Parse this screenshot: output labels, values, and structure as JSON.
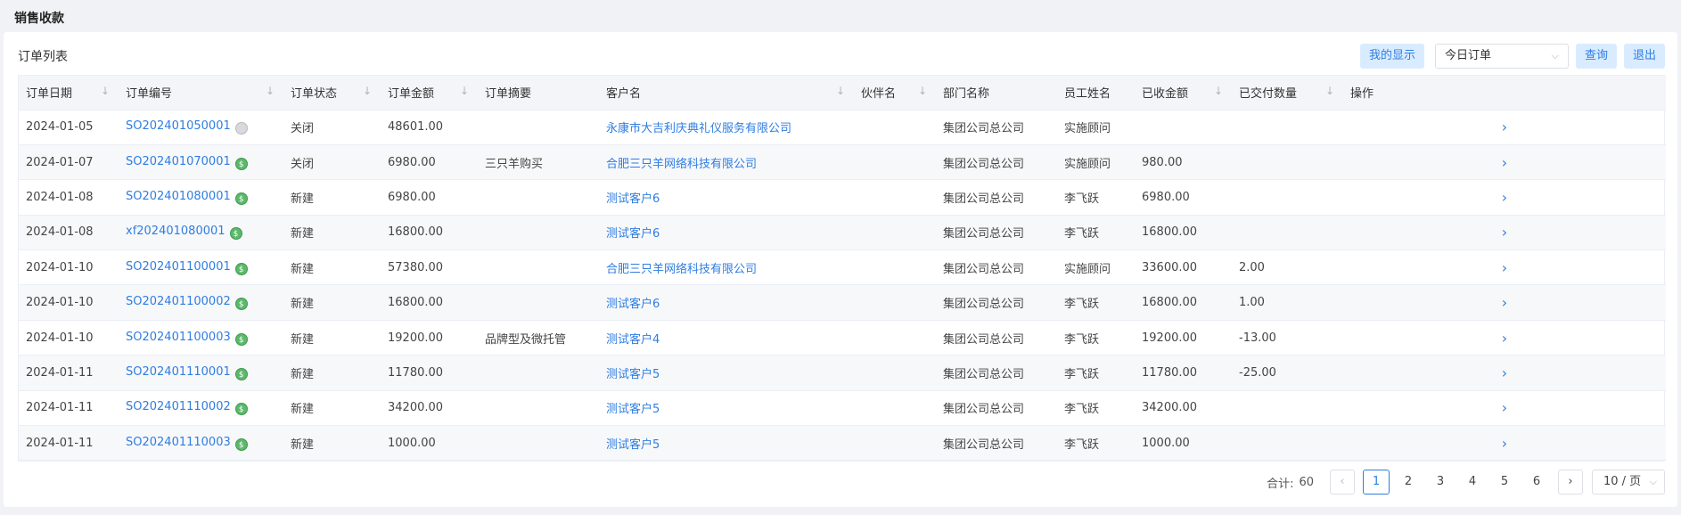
{
  "header": {
    "title": "销售收款"
  },
  "panel": {
    "title": "订单列表"
  },
  "toolbar": {
    "my_display": "我的显示",
    "filter_value": "今日订单",
    "query": "查询",
    "exit": "退出"
  },
  "table": {
    "columns": [
      "订单日期",
      "订单编号",
      "订单状态",
      "订单金额",
      "订单摘要",
      "客户名",
      "伙伴名",
      "部门名称",
      "员工姓名",
      "已收金额",
      "已交付数量",
      "操作"
    ],
    "rows": [
      {
        "date": "2024-01-05",
        "no": "SO202401050001",
        "pay": "grey",
        "status": "关闭",
        "amount": "48601.00",
        "summary": "",
        "customer": "永康市大吉利庆典礼仪服务有限公司",
        "partner": "",
        "dept": "集团公司总公司",
        "staff": "实施顾问",
        "received": "",
        "delivered": ""
      },
      {
        "date": "2024-01-07",
        "no": "SO202401070001",
        "pay": "green",
        "status": "关闭",
        "amount": "6980.00",
        "summary": "三只羊购买",
        "customer": "合肥三只羊网络科技有限公司",
        "partner": "",
        "dept": "集团公司总公司",
        "staff": "实施顾问",
        "received": "980.00",
        "delivered": ""
      },
      {
        "date": "2024-01-08",
        "no": "SO202401080001",
        "pay": "green",
        "status": "新建",
        "amount": "6980.00",
        "summary": "",
        "customer": "测试客户6",
        "partner": "",
        "dept": "集团公司总公司",
        "staff": "李飞跃",
        "received": "6980.00",
        "delivered": ""
      },
      {
        "date": "2024-01-08",
        "no": "xf202401080001",
        "pay": "green",
        "status": "新建",
        "amount": "16800.00",
        "summary": "",
        "customer": "测试客户6",
        "partner": "",
        "dept": "集团公司总公司",
        "staff": "李飞跃",
        "received": "16800.00",
        "delivered": ""
      },
      {
        "date": "2024-01-10",
        "no": "SO202401100001",
        "pay": "green",
        "status": "新建",
        "amount": "57380.00",
        "summary": "",
        "customer": "合肥三只羊网络科技有限公司",
        "partner": "",
        "dept": "集团公司总公司",
        "staff": "实施顾问",
        "received": "33600.00",
        "delivered": "2.00"
      },
      {
        "date": "2024-01-10",
        "no": "SO202401100002",
        "pay": "green",
        "status": "新建",
        "amount": "16800.00",
        "summary": "",
        "customer": "测试客户6",
        "partner": "",
        "dept": "集团公司总公司",
        "staff": "李飞跃",
        "received": "16800.00",
        "delivered": "1.00"
      },
      {
        "date": "2024-01-10",
        "no": "SO202401100003",
        "pay": "green",
        "status": "新建",
        "amount": "19200.00",
        "summary": "品牌型及微托管",
        "customer": "测试客户4",
        "partner": "",
        "dept": "集团公司总公司",
        "staff": "李飞跃",
        "received": "19200.00",
        "delivered": "-13.00"
      },
      {
        "date": "2024-01-11",
        "no": "SO202401110001",
        "pay": "green",
        "status": "新建",
        "amount": "11780.00",
        "summary": "",
        "customer": "测试客户5",
        "partner": "",
        "dept": "集团公司总公司",
        "staff": "李飞跃",
        "received": "11780.00",
        "delivered": "-25.00"
      },
      {
        "date": "2024-01-11",
        "no": "SO202401110002",
        "pay": "green",
        "status": "新建",
        "amount": "34200.00",
        "summary": "",
        "customer": "测试客户5",
        "partner": "",
        "dept": "集团公司总公司",
        "staff": "李飞跃",
        "received": "34200.00",
        "delivered": ""
      },
      {
        "date": "2024-01-11",
        "no": "SO202401110003",
        "pay": "green",
        "status": "新建",
        "amount": "1000.00",
        "summary": "",
        "customer": "测试客户5",
        "partner": "",
        "dept": "集团公司总公司",
        "staff": "李飞跃",
        "received": "1000.00",
        "delivered": ""
      }
    ]
  },
  "pagination": {
    "total_label": "合计:",
    "total": "60",
    "pages": [
      "1",
      "2",
      "3",
      "4",
      "5",
      "6"
    ],
    "current": "1",
    "page_size": "10 / 页"
  }
}
